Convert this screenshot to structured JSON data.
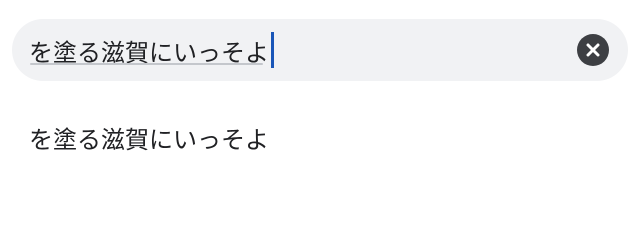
{
  "search": {
    "query": "を塗る滋賀にいっそよ",
    "clear_icon": "close-circle-icon"
  },
  "suggestions": [
    {
      "label": "を塗る滋賀にいっそよ"
    }
  ]
}
